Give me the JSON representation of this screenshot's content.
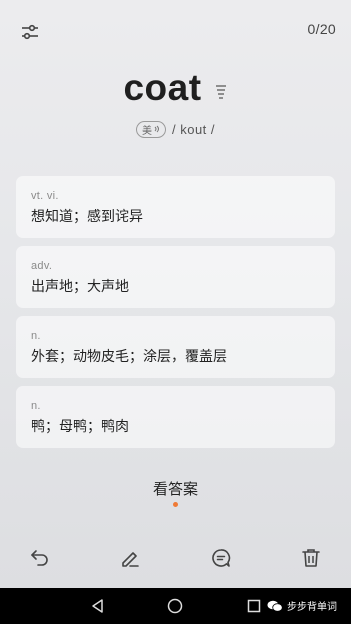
{
  "header": {
    "settings_icon": "sliders-icon",
    "progress": "0/20"
  },
  "word": {
    "text": "coat",
    "accent_label": "美",
    "phonetic": "/ kout /"
  },
  "definitions": [
    {
      "pos": "vt. vi.",
      "meaning": "想知道；感到诧异"
    },
    {
      "pos": "adv.",
      "meaning": "出声地；大声地"
    },
    {
      "pos": "n.",
      "meaning": "外套；动物皮毛；涂层，覆盖层"
    },
    {
      "pos": "n.",
      "meaning": "鸭；母鸭；鸭肉"
    }
  ],
  "answer_label": "看答案",
  "colors": {
    "accent": "#ef7a36"
  },
  "bottom_bar": [
    "undo-icon",
    "edit-icon",
    "note-icon",
    "trash-icon"
  ],
  "navbar": {
    "brand": "步步背单词"
  }
}
